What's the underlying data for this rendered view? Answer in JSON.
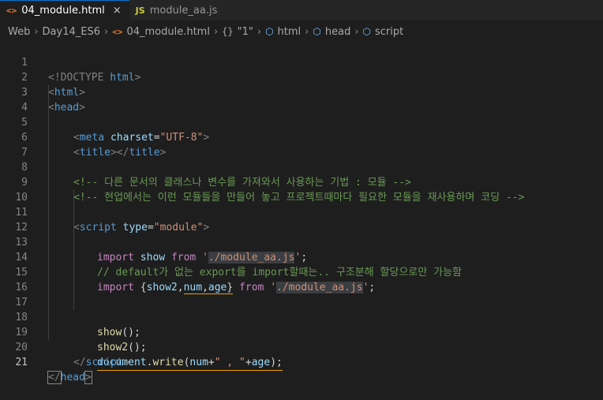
{
  "tabs": [
    {
      "icon": "<>",
      "label": "04_module.html",
      "close": "×"
    },
    {
      "icon": "JS",
      "label": "module_aa.js"
    }
  ],
  "breadcrumb": {
    "items": [
      "Web",
      "Day14_ES6",
      "04_module.html",
      "\"1\"",
      "html",
      "head",
      "script"
    ],
    "html_icon": "<>",
    "brace_icon": "{}"
  },
  "editor": {
    "line_numbers": [
      "1",
      "2",
      "3",
      "4",
      "5",
      "6",
      "7",
      "8",
      "9",
      "10",
      "11",
      "12",
      "13",
      "14",
      "15",
      "16",
      "17",
      "18",
      "19",
      "20",
      "21"
    ],
    "lines": {
      "l1": {
        "open": "<!DOCTYPE",
        "tag": " html",
        "close": ">"
      },
      "l2": {
        "open": "<",
        "tag": "html",
        "close": ">"
      },
      "l3": {
        "open": "<",
        "tag": "head",
        "close": ">"
      },
      "l4": {
        "open": "<",
        "tag": "meta",
        "attr": " charset",
        "eq": "=",
        "val": "\"UTF-8\"",
        "close": ">"
      },
      "l5": {
        "open1": "<",
        "tag1": "title",
        "close1": "></",
        "tag2": "title",
        "close2": ">"
      },
      "l7": "<!-- 다른 문서의 클래스나 변수를 가져와서 사용하는 기법 : 모듈 -->",
      "l8": "<!-- 현업에서는 이런 모듈들을 만들어 놓고 프로젝트때마다 필요한 모듈을 재사용하며 코딩 -->",
      "l10": {
        "open": "<",
        "tag": "script",
        "attr": " type",
        "eq": "=",
        "val": "\"module\"",
        "close": ">"
      },
      "l11": {
        "kw1": "import",
        "name": " show ",
        "kw2": "from",
        "sp": " ",
        "q1": "'",
        "path": "./module_aa.js",
        "q2": "'",
        "end": ";"
      },
      "l12": "// default가 없는 export를 import할때는.. 구조분해 할당으로만 가능함",
      "l13": {
        "kw1": "import",
        "brace_open": " {",
        "n1": "show2",
        "c1": ",",
        "n2": "num",
        "c2": ",",
        "n3": "age",
        "brace_close": "}",
        "sp1": " ",
        "kw2": "from",
        "sp2": " ",
        "q1": "'",
        "path": "./module_aa.js",
        "q2": "'",
        "end": ";"
      },
      "l16": {
        "fn": "show",
        "rest": "();"
      },
      "l17": {
        "fn": "show2",
        "rest": "();"
      },
      "l18": {
        "obj": "document",
        "dot": ".",
        "fn": "write",
        "p1": "(",
        "a1": "num",
        "plus1": "+",
        "str": "\" , \"",
        "plus2": "+",
        "a2": "age",
        "p2": ");"
      },
      "l19": {
        "open": "</",
        "tag": "script",
        "close": ">"
      },
      "l21": {
        "open": "</",
        "tag": "head",
        "close": ">"
      }
    }
  }
}
